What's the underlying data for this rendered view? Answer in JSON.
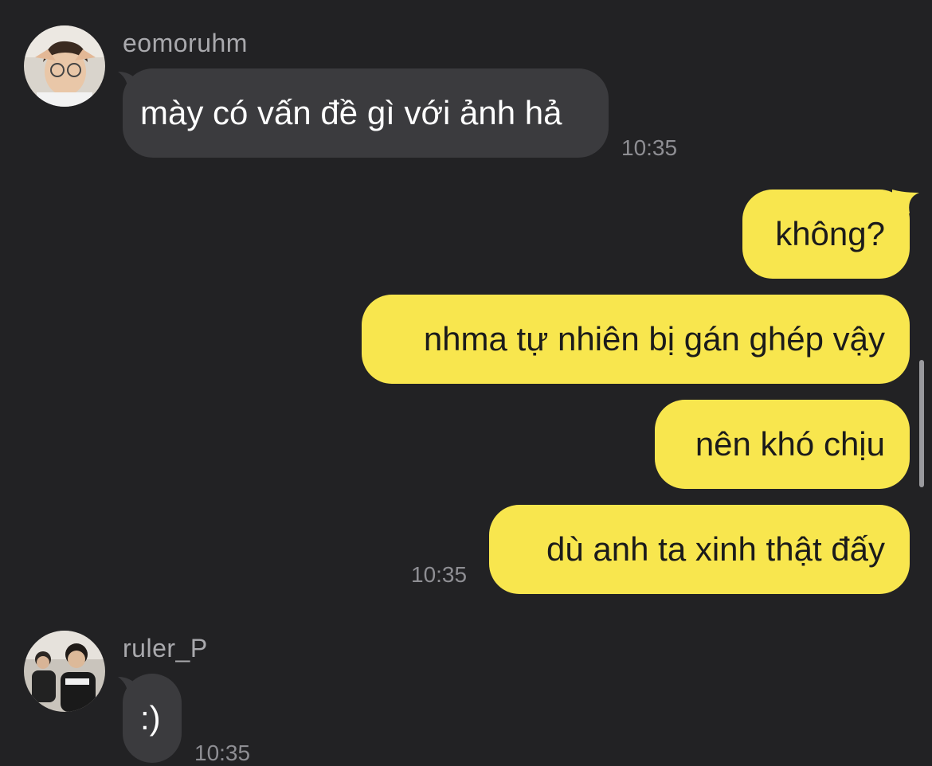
{
  "messages": {
    "eomoruhm": {
      "username": "eomoruhm",
      "avatar_icon": "person-photo-avatar",
      "text": "mày có vấn đề gì với ảnh hả",
      "time": "10:35"
    },
    "outgoing": {
      "texts": [
        "không?",
        "nhma tự nhiên bị gán ghép vậy",
        "nên khó chịu",
        "dù anh ta xinh thật đấy"
      ],
      "time": "10:35"
    },
    "ruler": {
      "username": "ruler_P",
      "avatar_icon": "group-photo-avatar",
      "text": ":)",
      "time": "10:35"
    }
  },
  "colors": {
    "background": "#222224",
    "incoming_bubble": "#3b3b3e",
    "outgoing_bubble": "#f8e64e",
    "username": "#a9a9ad",
    "timestamp": "#8e8e93"
  }
}
